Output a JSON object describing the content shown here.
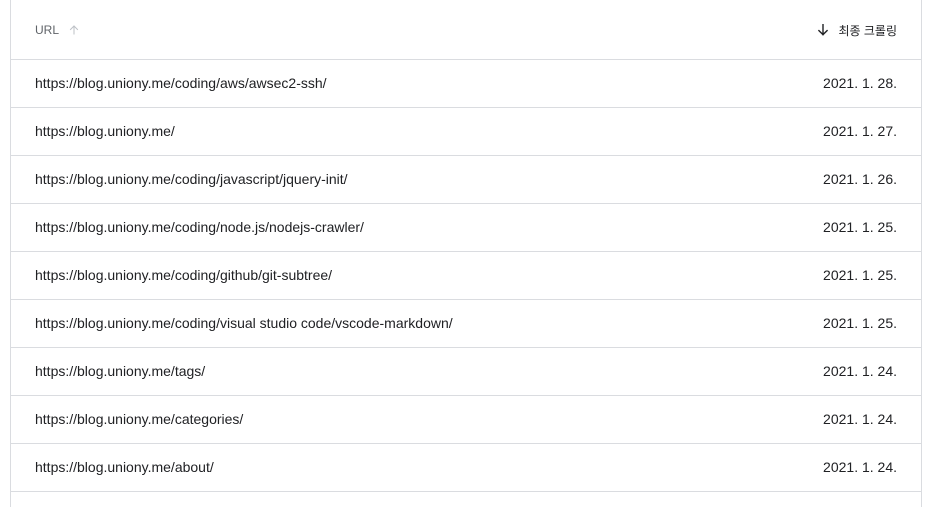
{
  "table": {
    "header": {
      "url_label": "URL",
      "date_label": "최종 크롤링"
    },
    "rows": [
      {
        "url": "https://blog.uniony.me/coding/aws/awsec2-ssh/",
        "date": "2021. 1. 28."
      },
      {
        "url": "https://blog.uniony.me/",
        "date": "2021. 1. 27."
      },
      {
        "url": "https://blog.uniony.me/coding/javascript/jquery-init/",
        "date": "2021. 1. 26."
      },
      {
        "url": "https://blog.uniony.me/coding/node.js/nodejs-crawler/",
        "date": "2021. 1. 25."
      },
      {
        "url": "https://blog.uniony.me/coding/github/git-subtree/",
        "date": "2021. 1. 25."
      },
      {
        "url": "https://blog.uniony.me/coding/visual studio code/vscode-markdown/",
        "date": "2021. 1. 25."
      },
      {
        "url": "https://blog.uniony.me/tags/",
        "date": "2021. 1. 24."
      },
      {
        "url": "https://blog.uniony.me/categories/",
        "date": "2021. 1. 24."
      },
      {
        "url": "https://blog.uniony.me/about/",
        "date": "2021. 1. 24."
      }
    ]
  },
  "icons": {
    "url_sort": "arrow-up-icon",
    "date_sort": "arrow-down-icon"
  },
  "colors": {
    "border": "#dadce0",
    "text_primary": "#202124",
    "text_secondary": "#5f6368",
    "icon_inactive": "#bdc1c6"
  }
}
